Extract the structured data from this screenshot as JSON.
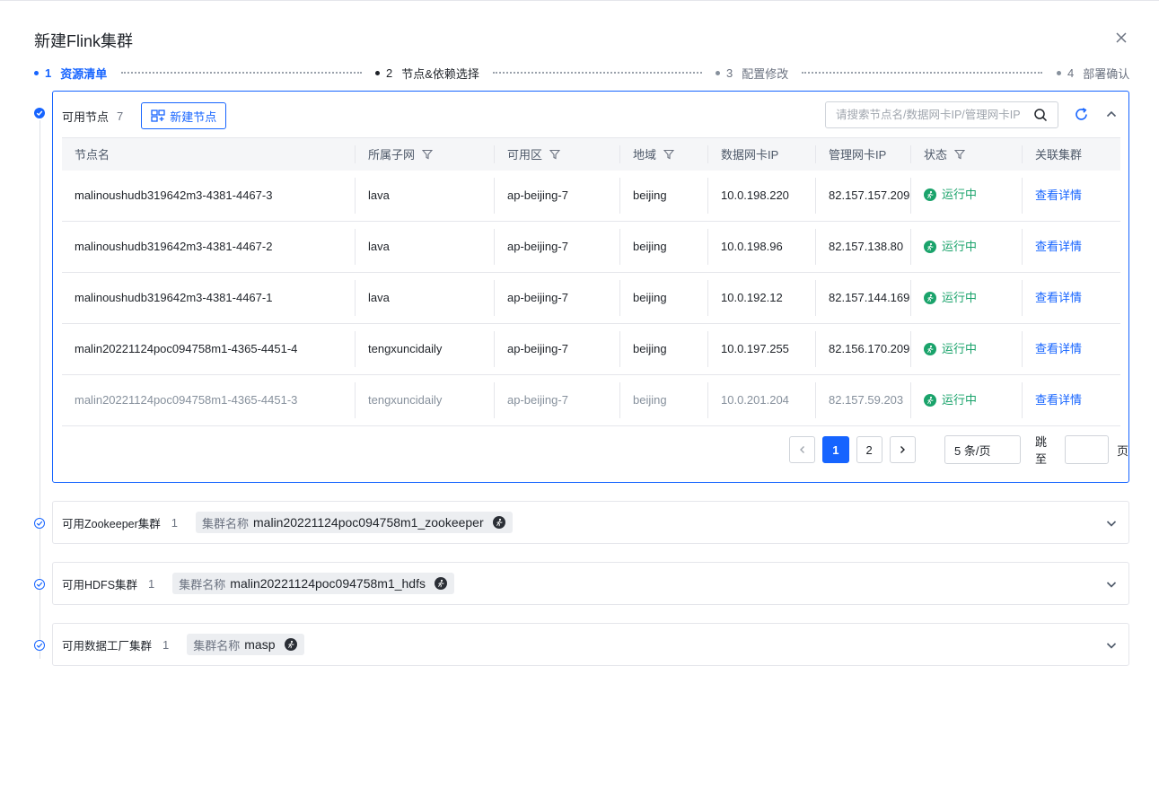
{
  "dialog": {
    "title": "新建Flink集群"
  },
  "steps": [
    {
      "num": "1",
      "label": "资源清单"
    },
    {
      "num": "2",
      "label": "节点&依赖选择"
    },
    {
      "num": "3",
      "label": "配置修改"
    },
    {
      "num": "4",
      "label": "部署确认"
    }
  ],
  "nodes": {
    "label": "可用节点",
    "count": "7",
    "new_button": "新建节点",
    "search_placeholder": "请搜索节点名/数据网卡IP/管理网卡IP",
    "columns": [
      "节点名",
      "所属子网",
      "可用区",
      "地域",
      "数据网卡IP",
      "管理网卡IP",
      "状态",
      "关联集群"
    ],
    "rows": [
      {
        "name": "malinoushudb319642m3-4381-4467-3",
        "subnet": "lava",
        "zone": "ap-beijing-7",
        "region": "beijing",
        "data_ip": "10.0.198.220",
        "mgmt_ip": "82.157.157.209",
        "status": "运行中",
        "link": "查看详情"
      },
      {
        "name": "malinoushudb319642m3-4381-4467-2",
        "subnet": "lava",
        "zone": "ap-beijing-7",
        "region": "beijing",
        "data_ip": "10.0.198.96",
        "mgmt_ip": "82.157.138.80",
        "status": "运行中",
        "link": "查看详情"
      },
      {
        "name": "malinoushudb319642m3-4381-4467-1",
        "subnet": "lava",
        "zone": "ap-beijing-7",
        "region": "beijing",
        "data_ip": "10.0.192.12",
        "mgmt_ip": "82.157.144.169",
        "status": "运行中",
        "link": "查看详情"
      },
      {
        "name": "malin20221124poc094758m1-4365-4451-4",
        "subnet": "tengxuncidaily",
        "zone": "ap-beijing-7",
        "region": "beijing",
        "data_ip": "10.0.197.255",
        "mgmt_ip": "82.156.170.209",
        "status": "运行中",
        "link": "查看详情"
      },
      {
        "name": "malin20221124poc094758m1-4365-4451-3",
        "subnet": "tengxuncidaily",
        "zone": "ap-beijing-7",
        "region": "beijing",
        "data_ip": "10.0.201.204",
        "mgmt_ip": "82.157.59.203",
        "status": "运行中",
        "link": "查看详情"
      }
    ],
    "pagination": {
      "pages": [
        "1",
        "2"
      ],
      "current": "1",
      "page_size": "5 条/页",
      "jump_label": "跳至",
      "jump_unit": "页"
    }
  },
  "clusters": [
    {
      "label": "可用Zookeeper集群",
      "count": "1",
      "tag_key": "集群名称",
      "tag_value": "malin20221124poc094758m1_zookeeper"
    },
    {
      "label": "可用HDFS集群",
      "count": "1",
      "tag_key": "集群名称",
      "tag_value": "malin20221124poc094758m1_hdfs"
    },
    {
      "label": "可用数据工厂集群",
      "count": "1",
      "tag_key": "集群名称",
      "tag_value": "masp"
    }
  ],
  "colors": {
    "primary": "#1664ff",
    "success": "#1aa36b",
    "border": "#e5e6eb",
    "muted": "#86909c"
  }
}
